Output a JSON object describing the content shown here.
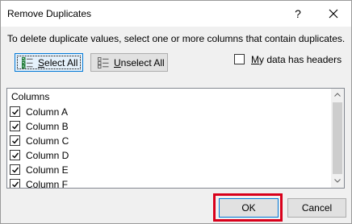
{
  "window": {
    "title": "Remove Duplicates",
    "help_glyph": "?"
  },
  "instruction": "To delete duplicate values, select one or more columns that contain duplicates.",
  "buttons": {
    "select_all": {
      "accel": "S",
      "rest": "elect All"
    },
    "unselect_all": {
      "accel": "U",
      "rest": "nselect All"
    },
    "ok": "OK",
    "cancel": "Cancel"
  },
  "headers_option": {
    "accel": "M",
    "rest": "y data has headers",
    "checked": false
  },
  "columns": {
    "header": "Columns",
    "items": [
      {
        "label": "Column A",
        "checked": true
      },
      {
        "label": "Column B",
        "checked": true
      },
      {
        "label": "Column C",
        "checked": true
      },
      {
        "label": "Column D",
        "checked": true
      },
      {
        "label": "Column E",
        "checked": true
      },
      {
        "label": "Column F",
        "checked": true
      }
    ]
  },
  "colors": {
    "highlight": "#d9001b",
    "focus_border": "#0078d7"
  }
}
